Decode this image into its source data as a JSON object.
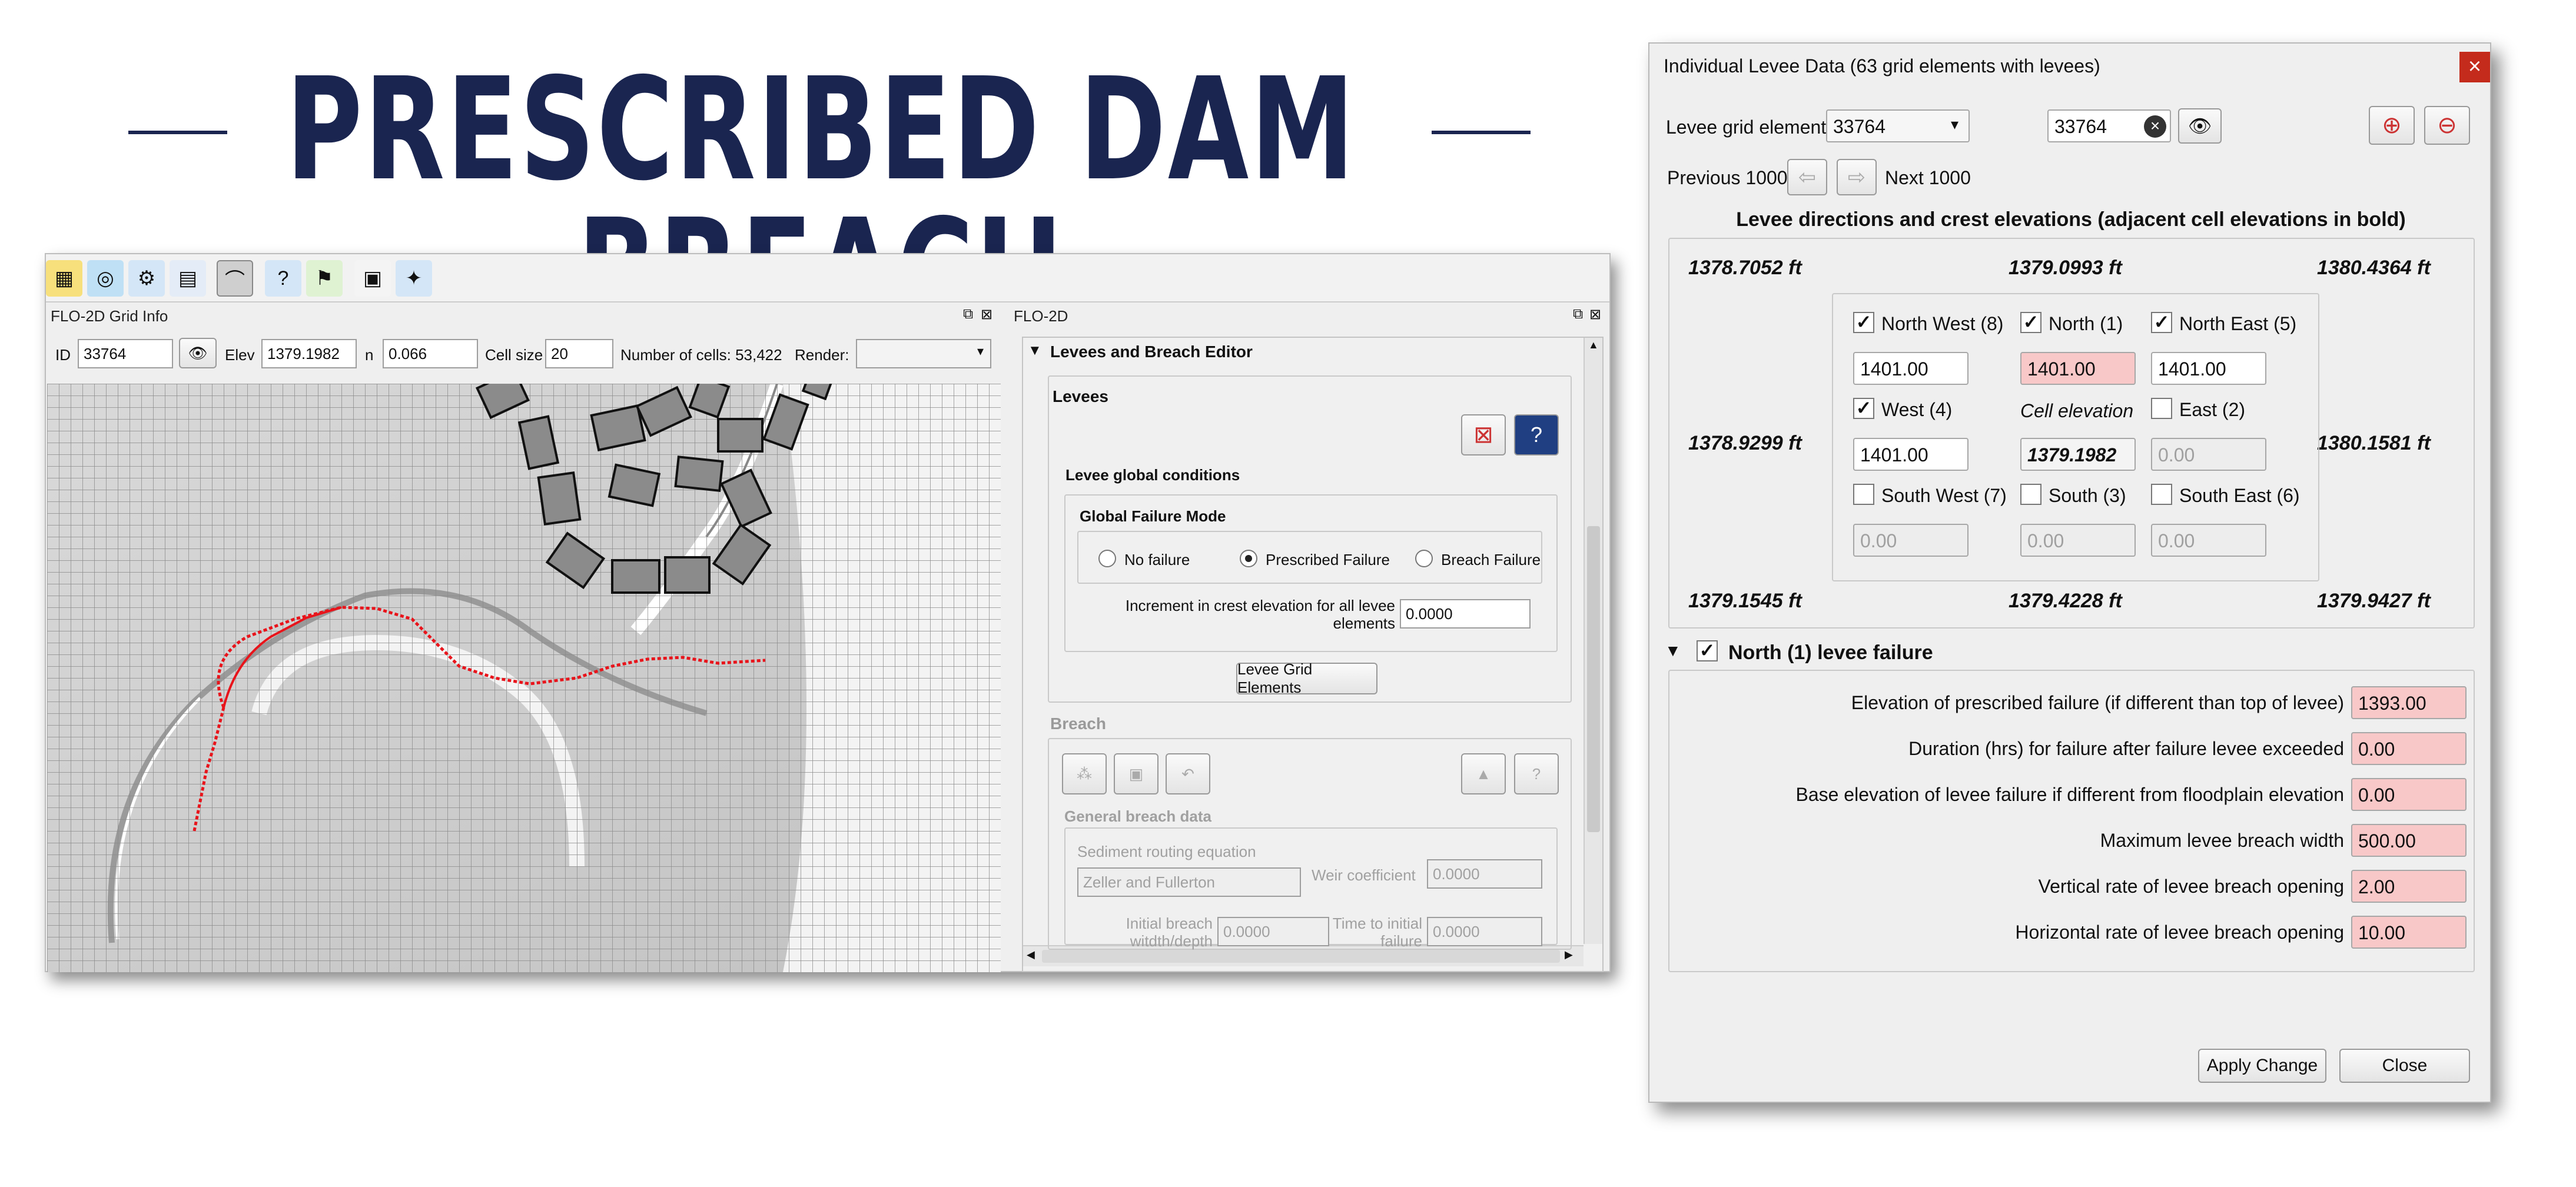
{
  "title": "PRESCRIBED DAM BREACH",
  "colors": {
    "title": "#1a2550",
    "levee_line": "#e8141b",
    "required_field": "#f8c8c8"
  },
  "toolbar": {
    "icons": [
      "grid-tools-icon",
      "globe-settings-icon",
      "run-icon",
      "grid-table-icon",
      "levee-icon",
      "help-tools-icon",
      "info-flag-icon",
      "report-icon",
      "settings-icon"
    ]
  },
  "grid_info": {
    "panel_title": "FLO-2D Grid Info",
    "id_label": "ID",
    "id_value": "33764",
    "elev_label": "Elev",
    "elev_value": "1379.1982",
    "n_label": "n",
    "n_value": "0.066",
    "cellsize_label": "Cell size",
    "cellsize_value": "20",
    "cells_text": "Number of cells: 53,422",
    "render_label": "Render:",
    "render_value": ""
  },
  "flo2d": {
    "panel_title": "FLO-2D",
    "section_title": "Levees and Breach Editor",
    "levees_label": "Levees",
    "global_conditions": "Levee global conditions",
    "failure_mode": "Global Failure Mode",
    "radio_no_failure": "No failure",
    "radio_prescribed": "Prescribed Failure",
    "radio_breach": "Breach Failure",
    "increment_label_1": "Increment in crest elevation for all levee",
    "increment_label_2": "elements",
    "increment_value": "0.0000",
    "grid_elements_button": "Levee Grid Elements",
    "breach_label": "Breach",
    "general_breach": "General breach data",
    "sediment_label": "Sediment routing equation",
    "sediment_value": "Zeller and Fullerton",
    "weir_label": "Weir coefficient",
    "weir_value": "0.0000",
    "initial_breach_1": "Initial breach",
    "initial_breach_2": "witdth/depth",
    "initial_breach_value": "0.0000",
    "time_initial_1": "Time to initial",
    "time_initial_2": "failure",
    "time_initial_value": "0.0000"
  },
  "dialog": {
    "title": "Individual Levee Data (63 grid elements with levees)",
    "close_x": "×",
    "grid_element_label": "Levee grid element",
    "grid_element_value": "33764",
    "search_value": "33764",
    "prev_label": "Previous 1000",
    "next_label": "Next 1000",
    "directions_heading": "Levee directions and crest elevations (adjacent cell elevations in bold)",
    "adjacent": {
      "nw": "1378.7052  ft",
      "n": "1379.0993  ft",
      "ne": "1380.4364  ft",
      "w": "1378.9299  ft",
      "e": "1380.1581  ft",
      "sw": "1379.1545  ft",
      "s": "1379.4228  ft",
      "se": "1379.9427  ft"
    },
    "directions": {
      "nw_label": "North West (8)",
      "nw_value": "1401.00",
      "n_label": "North (1)",
      "n_value": "1401.00",
      "ne_label": "North East (5)",
      "ne_value": "1401.00",
      "w_label": "West (4)",
      "w_value": "1401.00",
      "cell_label": "Cell elevation",
      "cell_value": "1379.1982",
      "e_label": "East (2)",
      "e_value": "0.00",
      "sw_label": "South West (7)",
      "sw_value": "0.00",
      "s_label": "South (3)",
      "s_value": "0.00",
      "se_label": "South East (6)",
      "se_value": "0.00"
    },
    "failure_section": "North (1)  levee failure",
    "failure_rows": [
      {
        "label": "Elevation of prescribed failure (if different than top of levee)",
        "value": "1393.00"
      },
      {
        "label": "Duration (hrs) for failure after failure levee exceeded",
        "value": "0.00"
      },
      {
        "label": "Base elevation of levee failure if different from floodplain elevation",
        "value": "0.00"
      },
      {
        "label": "Maximum levee breach width",
        "value": "500.00"
      },
      {
        "label": "Vertical rate of levee breach opening",
        "value": "2.00"
      },
      {
        "label": "Horizontal rate of levee breach opening",
        "value": "10.00"
      }
    ],
    "apply_button": "Apply Change",
    "close_button": "Close"
  }
}
